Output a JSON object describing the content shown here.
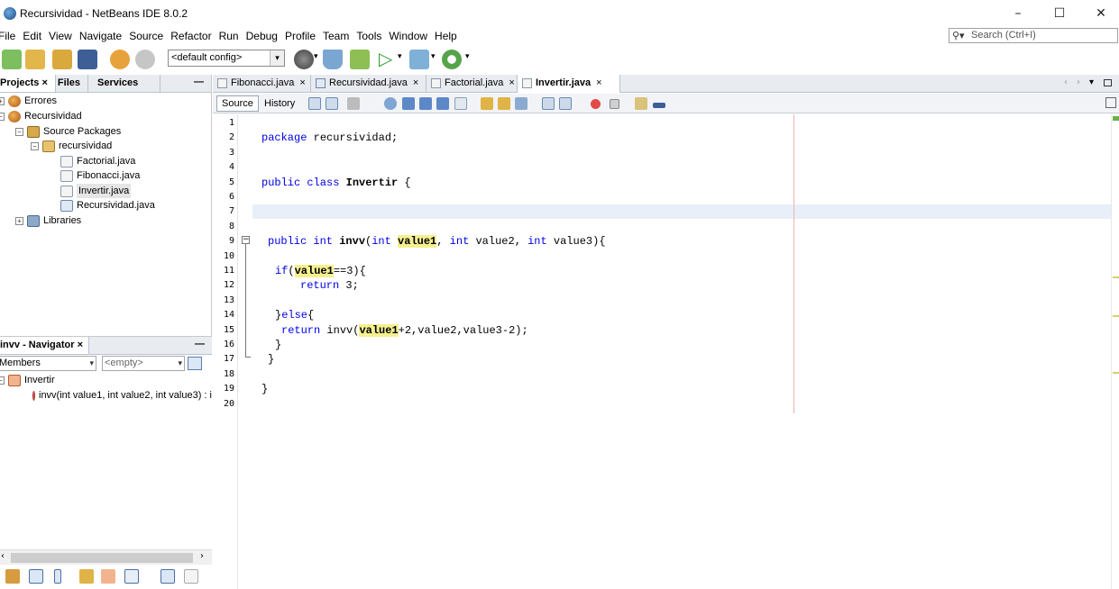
{
  "window": {
    "title": "Recursividad - NetBeans IDE 8.0.2",
    "minimize": "–",
    "maximize": "☐",
    "close": "✕"
  },
  "menu": [
    "File",
    "Edit",
    "View",
    "Navigate",
    "Source",
    "Refactor",
    "Run",
    "Debug",
    "Profile",
    "Team",
    "Tools",
    "Window",
    "Help"
  ],
  "search": {
    "placeholder": "Search (Ctrl+I)",
    "icon": "search-icon"
  },
  "toolbar": {
    "config": "<default config>"
  },
  "projects_panel": {
    "tabs": [
      "Projects",
      "Files",
      "Services"
    ],
    "close": "×",
    "minimize": "—",
    "tree": [
      {
        "label": "Errores",
        "icon": "project-icon"
      },
      {
        "label": "Recursividad",
        "icon": "project-icon"
      },
      {
        "label": "Source Packages",
        "icon": "package-folder-icon"
      },
      {
        "label": "recursividad",
        "icon": "package-icon"
      },
      {
        "label": "Factorial.java",
        "icon": "java-file-icon"
      },
      {
        "label": "Fibonacci.java",
        "icon": "java-file-icon"
      },
      {
        "label": "Invertir.java",
        "icon": "java-file-icon"
      },
      {
        "label": "Recursividad.java",
        "icon": "java-main-file-icon"
      },
      {
        "label": "Libraries",
        "icon": "libraries-icon"
      }
    ]
  },
  "navigator": {
    "title": "invv - Navigator",
    "close": "×",
    "minimize": "—",
    "members_combo": "Members",
    "filter_combo": "<empty>",
    "tree": [
      {
        "label": "Invertir",
        "icon": "class-icon"
      },
      {
        "label": "invv(int value1, int value2, int value3) : i",
        "icon": "method-icon"
      }
    ]
  },
  "editor": {
    "tabs": [
      {
        "label": "Fibonacci.java",
        "close": "×"
      },
      {
        "label": "Recursividad.java",
        "close": "×"
      },
      {
        "label": "Factorial.java",
        "close": "×"
      },
      {
        "label": "Invertir.java",
        "close": "×"
      }
    ],
    "active_tab": "Invertir.java",
    "view_tabs": [
      "Source",
      "History"
    ],
    "line_numbers": [
      "1",
      "2",
      "3",
      "4",
      "5",
      "6",
      "7",
      "8",
      "9",
      "10",
      "11",
      "12",
      "13",
      "14",
      "15",
      "16",
      "17",
      "18",
      "19",
      "20"
    ],
    "code": {
      "l2_kw": "package",
      "l2_rest": " recursividad;",
      "l5_kw": "public class",
      "l5_name": " Invertir",
      "l5_rest": " {",
      "l9_kw1": "public int",
      "l9_name": " invv",
      "l9_p1": "(",
      "l9_kw2": "int",
      "l9_sp": " ",
      "l9_v1": "value1",
      "l9_p2": ", ",
      "l9_kw3": "int",
      "l9_p3": " value2, ",
      "l9_kw4": "int",
      "l9_p4": " value3){",
      "l11_kw": "if",
      "l11_p1": "(",
      "l11_v1": "value1",
      "l11_p2": "==3){",
      "l12_kw": "return",
      "l12_rest": " 3;",
      "l14_p1": "}",
      "l14_kw": "else",
      "l14_p2": "{",
      "l15_kw": "return",
      "l15_p1": " invv(",
      "l15_v1": "value1",
      "l15_p2": "+2,value2,value3-2);",
      "l16": "}",
      "l17": "}",
      "l19": "}"
    }
  },
  "colors": {
    "keyword": "#0000e6",
    "occurrence_highlight": "#f4f08e",
    "current_line": "#e9eff8"
  }
}
